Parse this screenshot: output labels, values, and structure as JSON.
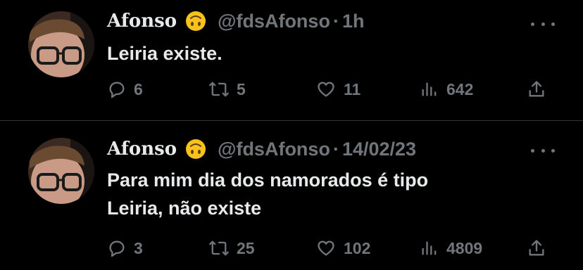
{
  "tweets": [
    {
      "author": "Afonso",
      "handle": "@fdsAfonso",
      "separator": "·",
      "time": "1h",
      "lines": [
        "Leiria existe."
      ],
      "replies": "6",
      "retweets": "5",
      "likes": "11",
      "views": "642"
    },
    {
      "author": "Afonso",
      "handle": "@fdsAfonso",
      "separator": "·",
      "time": "14/02/23",
      "lines": [
        "Para mim dia dos namorados é tipo",
        "Leiria, não existe"
      ],
      "replies": "3",
      "retweets": "25",
      "likes": "102",
      "views": "4809"
    }
  ],
  "icons": {
    "author_emoji": "upside-down-face-emoji",
    "reply": "reply-icon",
    "retweet": "retweet-icon",
    "like": "heart-icon",
    "views": "views-icon",
    "share": "share-icon",
    "more": "more-icon"
  },
  "colors": {
    "background": "#000000",
    "text": "#e7e9ea",
    "secondary": "#71767b",
    "divider": "#2f3336"
  }
}
